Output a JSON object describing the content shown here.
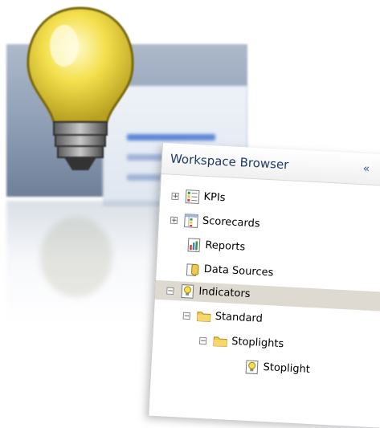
{
  "panel": {
    "title": "Workspace Browser",
    "collapse_glyph": "«"
  },
  "tree": {
    "expand_glyph": "+",
    "collapse_glyph": "−",
    "items": [
      {
        "label": "KPIs",
        "icon": "kpi-icon",
        "expander": "collapsed"
      },
      {
        "label": "Scorecards",
        "icon": "scorecard-icon",
        "expander": "collapsed"
      },
      {
        "label": "Reports",
        "icon": "report-icon",
        "expander": "none"
      },
      {
        "label": "Data Sources",
        "icon": "data-source-icon",
        "expander": "none"
      },
      {
        "label": "Indicators",
        "icon": "indicator-icon",
        "expander": "expanded",
        "selected": true
      },
      {
        "label": "Standard",
        "icon": "folder-icon",
        "expander": "expanded"
      },
      {
        "label": "Stoplights",
        "icon": "folder-icon",
        "expander": "expanded"
      },
      {
        "label": "Stoplight",
        "icon": "indicator-icon",
        "expander": "none"
      }
    ]
  },
  "colors": {
    "header_text": "#1e3a6a",
    "selected_row": "#dedad2",
    "folder": "#f2c94c",
    "bulb": "#f4e04d"
  }
}
